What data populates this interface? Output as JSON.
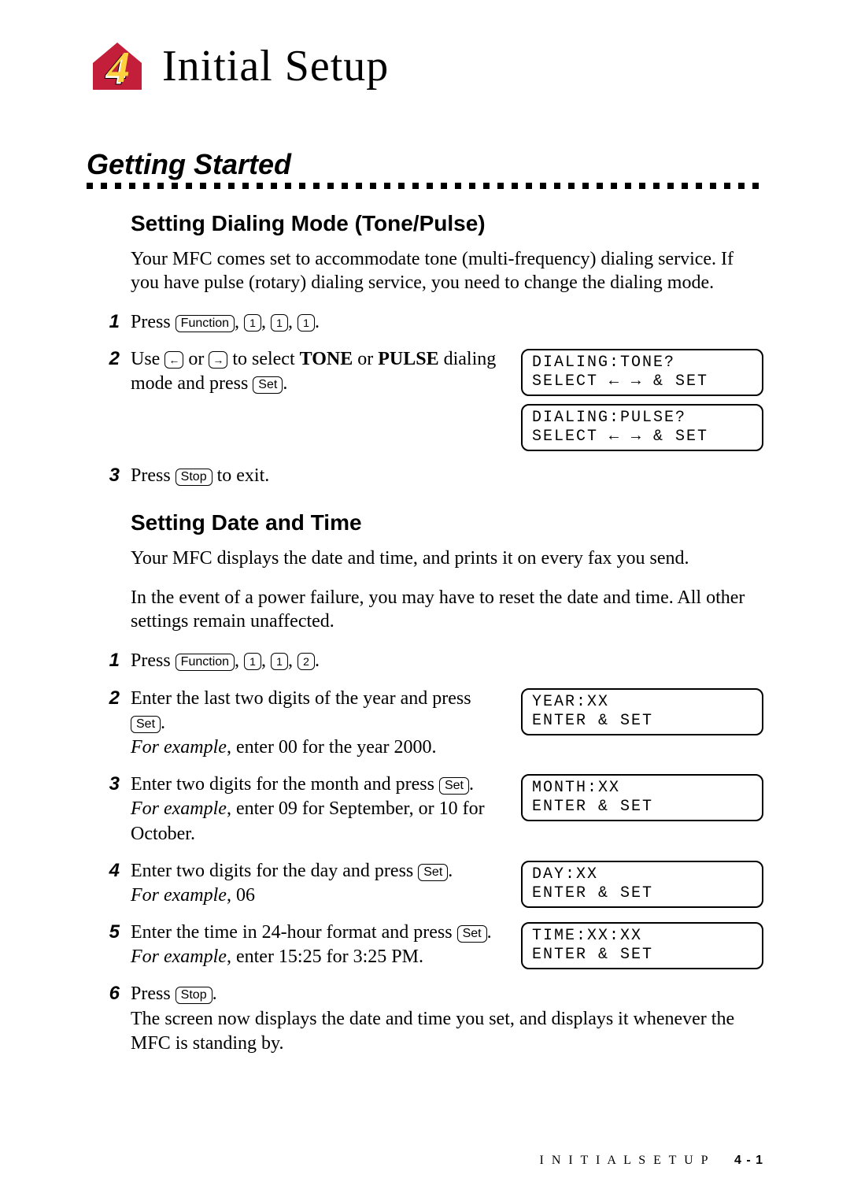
{
  "chapter": {
    "number": "4",
    "title": "Initial Setup"
  },
  "section": {
    "heading": "Getting Started"
  },
  "dialing": {
    "heading": "Setting Dialing Mode (Tone/Pulse)",
    "intro": "Your MFC comes set to accommodate tone (multi-frequency) dialing service. If you have pulse (rotary) dialing service, you need to change the dialing mode.",
    "steps": {
      "s1": {
        "num": "1",
        "press": "Press",
        "k_function": "Function",
        "comma1": ",",
        "k1a": "1",
        "comma2": ",",
        "k1b": "1",
        "comma3": ",",
        "k1c": "1",
        "dot": "."
      },
      "s2": {
        "num": "2",
        "pre": "Use ",
        "k_left": "←",
        "mid1": " or ",
        "k_right": "→",
        "mid2": " to select ",
        "tone": "TONE",
        "or": " or ",
        "pulse": "PULSE",
        "mid3": " dialing mode and press ",
        "k_set": "Set",
        "dot": ".",
        "lcd1_l1": "DIALING:TONE?",
        "lcd1_l2": "SELECT ← → & SET",
        "lcd2_l1": "DIALING:PULSE?",
        "lcd2_l2": "SELECT ← → & SET"
      },
      "s3": {
        "num": "3",
        "press": "Press ",
        "k_stop": "Stop",
        "tail": " to exit."
      }
    }
  },
  "datetime": {
    "heading": "Setting Date and Time",
    "intro1": "Your MFC displays the date and time, and prints it on every fax you send.",
    "intro2": "In the event of a power failure, you may have to reset the date and time. All other settings remain unaffected.",
    "steps": {
      "s1": {
        "num": "1",
        "press": "Press",
        "k_function": "Function",
        "comma1": ",",
        "k1a": "1",
        "comma2": ",",
        "k1b": "1",
        "comma3": ",",
        "k2": "2",
        "dot": "."
      },
      "s2": {
        "num": "2",
        "line1a": "Enter the last two digits of the year and press ",
        "k_set": "Set",
        "dot": ".",
        "ex": "For example",
        "line2": ", enter 00 for the year 2000.",
        "lcd_l1": "YEAR:XX",
        "lcd_l2": "ENTER & SET"
      },
      "s3": {
        "num": "3",
        "line1a": "Enter two digits for the month and press ",
        "k_set": "Set",
        "dot": ".",
        "ex": "For example",
        "line2": ", enter 09 for September, or 10 for October.",
        "lcd_l1": "MONTH:XX",
        "lcd_l2": "ENTER & SET"
      },
      "s4": {
        "num": "4",
        "line1a": "Enter two digits for the day and press ",
        "k_set": "Set",
        "dot": ".",
        "ex": "For example",
        "line2": ", 06",
        "lcd_l1": "DAY:XX",
        "lcd_l2": "ENTER & SET"
      },
      "s5": {
        "num": "5",
        "line1a": "Enter the time in 24-hour format and press ",
        "k_set": "Set",
        "dot": ".",
        "ex": "For example",
        "line2": ", enter 15:25 for 3:25 PM.",
        "lcd_l1": "TIME:XX:XX",
        "lcd_l2": "ENTER & SET"
      },
      "s6": {
        "num": "6",
        "press": "Press ",
        "k_stop": "Stop",
        "dot": ".",
        "tail": "The screen now displays the date and time you set, and displays it whenever the MFC is standing by."
      }
    }
  },
  "footer": {
    "label": "I N I T I A L   S E T U P",
    "page": "4 - 1"
  }
}
